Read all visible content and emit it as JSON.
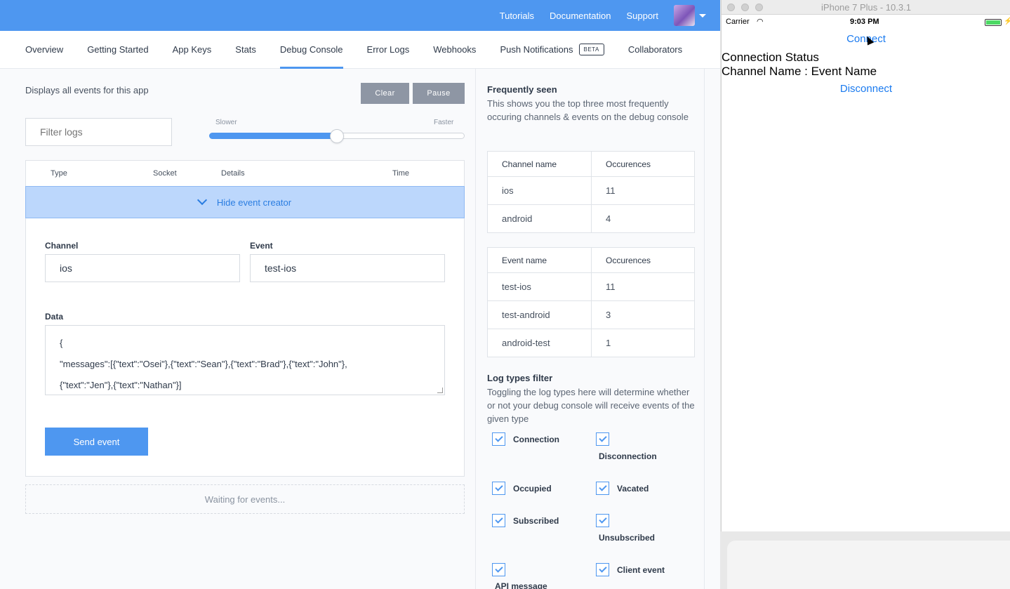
{
  "topnav": {
    "tutorials": "Tutorials",
    "documentation": "Documentation",
    "support": "Support"
  },
  "tabs": [
    "Overview",
    "Getting Started",
    "App Keys",
    "Stats",
    "Debug Console",
    "Error Logs",
    "Webhooks",
    "Push Notifications",
    "Collaborators"
  ],
  "beta_badge": "BETA",
  "console": {
    "description": "Displays all events for this app",
    "clear_label": "Clear",
    "pause_label": "Pause",
    "filter_placeholder": "Filter logs",
    "slider_slower": "Slower",
    "slider_faster": "Faster",
    "slider_level": 0.5,
    "columns": [
      "Type",
      "Socket",
      "Details",
      "Time"
    ],
    "hide_creator": "Hide event creator",
    "channel_label": "Channel",
    "channel_value": "ios",
    "event_label": "Event",
    "event_value": "test-ios",
    "data_label": "Data",
    "data_lines": [
      "{",
      "\"messages\":[{\"text\":\"Osei\"},{\"text\":\"Sean\"},{\"text\":\"Brad\"},{\"text\":\"John\"},",
      "{\"text\":\"Jen\"},{\"text\":\"Nathan\"}]"
    ],
    "send_label": "Send event",
    "waiting": "Waiting for events..."
  },
  "frequently": {
    "title": "Frequently seen",
    "text": "This shows you the top three most frequently occuring channels & events on the debug console",
    "channels_header": [
      "Channel name",
      "Occurences"
    ],
    "channels": [
      [
        "ios",
        "11"
      ],
      [
        "android",
        "4"
      ]
    ],
    "events_header": [
      "Event name",
      "Occurences"
    ],
    "events": [
      [
        "test-ios",
        "11"
      ],
      [
        "test-android",
        "3"
      ],
      [
        "android-test",
        "1"
      ]
    ]
  },
  "logfilter": {
    "title": "Log types filter",
    "text": "Toggling the log types here will determine whether or not your debug console will receive events of the given type",
    "items": [
      "Connection",
      "Disconnection",
      "Occupied",
      "Vacated",
      "Subscribed",
      "Unsubscribed",
      "API message",
      "Client event"
    ]
  },
  "simulator": {
    "title": "iPhone 7 Plus - 10.3.1",
    "carrier": "Carrier",
    "time": "9:03 PM",
    "connect": "Connect",
    "connection_status": "Connection Status",
    "channel_event": "Channel Name : Event Name",
    "disconnect": "Disconnect"
  },
  "colors": {
    "accent": "#4e97f0",
    "ios_blue": "#1a7aef"
  }
}
